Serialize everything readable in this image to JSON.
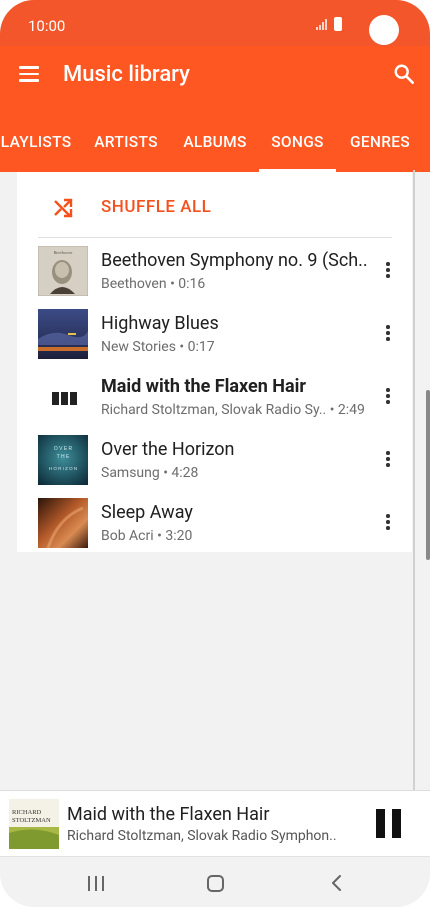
{
  "status_bar": {
    "time": "10:00"
  },
  "app_bar": {
    "title": "Music library"
  },
  "tabs": [
    {
      "label": "PLAYLISTS"
    },
    {
      "label": "ARTISTS"
    },
    {
      "label": "ALBUMS"
    },
    {
      "label": "SONGS",
      "active": true
    },
    {
      "label": "GENRES"
    }
  ],
  "shuffle": {
    "label": "SHUFFLE ALL"
  },
  "songs": [
    {
      "title": "Beethoven Symphony no. 9 (Sch..",
      "subtitle": "Beethoven • 0:16"
    },
    {
      "title": "Highway Blues",
      "subtitle": "New Stories • 0:17"
    },
    {
      "title": "Maid with the Flaxen Hair",
      "subtitle": "Richard Stoltzman, Slovak Radio Sy..  • 2:49",
      "playing": true
    },
    {
      "title": "Over the Horizon",
      "subtitle": "Samsung • 4:28"
    },
    {
      "title": "Sleep Away",
      "subtitle": "Bob Acri • 3:20"
    }
  ],
  "now_playing": {
    "title": "Maid with the Flaxen Hair",
    "subtitle": "Richard Stoltzman, Slovak Radio Symphon..",
    "art_text": {
      "line1": "RICHARD",
      "line2": "STOLTZMAN"
    }
  },
  "album_art_text": {
    "beethoven": "Beethoven",
    "horizon_line1": "O V E R",
    "horizon_line2": "T H E",
    "horizon_line3": "H O R I Z O N"
  },
  "colors": {
    "accent": "#ff5722",
    "shuffle_text": "#f4511e",
    "statusbar": "#f2562a"
  },
  "icons": {
    "menu": "menu-icon",
    "search": "search-icon",
    "shuffle": "shuffle-icon",
    "more": "more-vert-icon",
    "pause": "pause-icon",
    "equalizer": "equalizer-icon"
  }
}
